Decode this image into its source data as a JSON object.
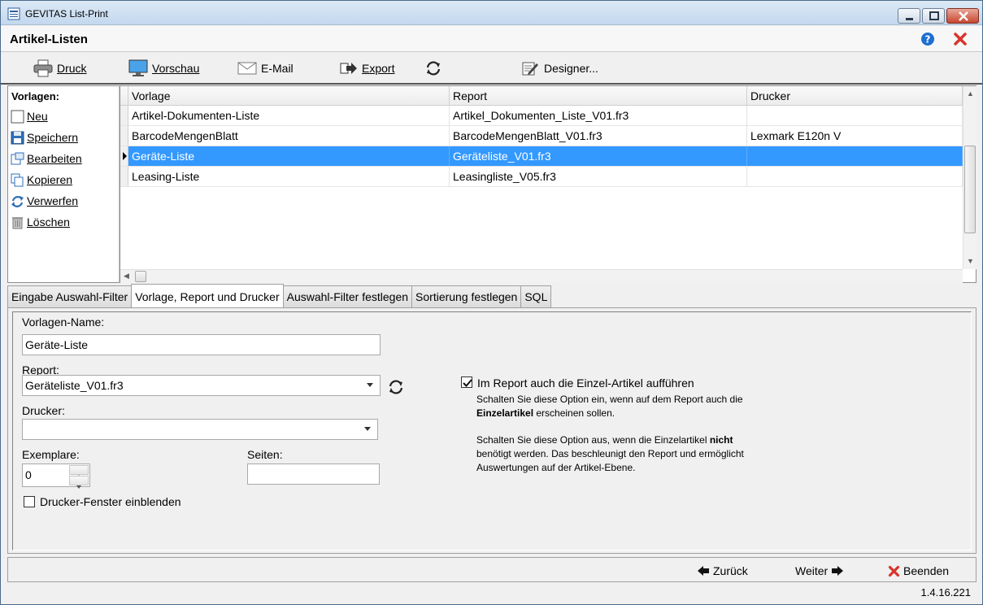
{
  "window": {
    "title": "GEVITAS List-Print"
  },
  "header": {
    "title": "Artikel-Listen"
  },
  "toolbar": {
    "druck": {
      "label": "Druck",
      "icon": "printer-icon"
    },
    "vorschau": {
      "label": "Vorschau",
      "icon": "monitor-icon"
    },
    "email": {
      "label": "E-Mail",
      "icon": "envelope-icon"
    },
    "export": {
      "label": "Export",
      "icon": "export-arrow-icon"
    },
    "refresh": {
      "icon": "refresh-icon"
    },
    "designer": {
      "label": "Designer...",
      "icon": "designer-pencil-icon"
    }
  },
  "sidebar": {
    "title": "Vorlagen:",
    "items": [
      {
        "label": "Neu",
        "icon": "new-document-icon"
      },
      {
        "label": "Speichern",
        "icon": "floppy-disk-icon"
      },
      {
        "label": "Bearbeiten",
        "icon": "edit-icon"
      },
      {
        "label": "Kopieren",
        "icon": "copy-icon"
      },
      {
        "label": "Verwerfen",
        "icon": "discard-icon"
      },
      {
        "label": "Löschen",
        "icon": "trash-icon"
      }
    ]
  },
  "grid": {
    "columns": [
      "Vorlage",
      "Report",
      "Drucker"
    ],
    "rows": [
      {
        "vorlage": "Artikel-Dokumenten-Liste",
        "report": "Artikel_Dokumenten_Liste_V01.fr3",
        "drucker": ""
      },
      {
        "vorlage": "BarcodeMengenBlatt",
        "report": "BarcodeMengenBlatt_V01.fr3",
        "drucker": "Lexmark E120n V"
      },
      {
        "vorlage": "Geräte-Liste",
        "report": "Geräteliste_V01.fr3",
        "drucker": "",
        "selected": true
      },
      {
        "vorlage": "Leasing-Liste",
        "report": "Leasingliste_V05.fr3",
        "drucker": ""
      }
    ]
  },
  "tabs": [
    {
      "label": "Eingabe Auswahl-Filter"
    },
    {
      "label": "Vorlage, Report und Drucker",
      "active": true
    },
    {
      "label": "Auswahl-Filter festlegen"
    },
    {
      "label": "Sortierung festlegen"
    },
    {
      "label": "SQL"
    }
  ],
  "form": {
    "vorlagen_name_label": "Vorlagen-Name:",
    "vorlagen_name_value": "Geräte-Liste",
    "report_label": "Report:",
    "report_value": "Geräteliste_V01.fr3",
    "drucker_label": "Drucker:",
    "drucker_value": "",
    "exemplare_label": "Exemplare:",
    "exemplare_value": "0",
    "seiten_label": "Seiten:",
    "seiten_value": "",
    "drucker_fenster_label": "Drucker-Fenster einblenden",
    "drucker_fenster_checked": false,
    "einzel_artikel_label": "Im Report auch die Einzel-Artikel aufführen",
    "einzel_artikel_checked": true,
    "hint1_line1": "Schalten Sie diese Option ein, wenn auf dem Report auch die",
    "hint1_bold": "Einzelartikel",
    "hint1_line2_rest": " erscheinen sollen.",
    "hint2_line1_pre": "Schalten Sie diese Option aus, wenn die Einzelartikel ",
    "hint2_bold": "nicht",
    "hint2_line2": "benötigt werden. Das beschleunigt den Report und ermöglicht",
    "hint2_line3": "Auswertungen auf der Artikel-Ebene."
  },
  "footer": {
    "back_label": "Zurück",
    "next_label": "Weiter",
    "exit_label": "Beenden",
    "version": "1.4.16.221"
  },
  "colors": {
    "selection": "#3399ff",
    "close_red": "#d9342b",
    "help_blue": "#1d6fd1"
  }
}
